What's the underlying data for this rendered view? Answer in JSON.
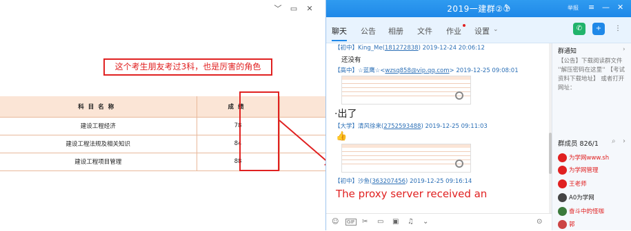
{
  "left_window": {
    "minimize": "﹀",
    "restore": "▭",
    "close": "✕",
    "annotation": "这个考生朋友考过3科，也是厉害的角色",
    "table": {
      "col_subject": "科目名称",
      "col_score": "成绩",
      "rows": [
        {
          "subject": "建设工程经济",
          "score": "78"
        },
        {
          "subject": "建设工程法规及相关知识",
          "score": "84"
        },
        {
          "subject": "建设工程项目管理",
          "score": "88"
        }
      ]
    }
  },
  "chat": {
    "title": "2019一建群②①",
    "report": "举报",
    "tabs": [
      "聊天",
      "公告",
      "相册",
      "文件",
      "作业",
      "设置"
    ],
    "messages": [
      {
        "tag": "【初中】",
        "name": "King_Me",
        "uid": "181272838",
        "time": "2019-12-24 20:06:12",
        "text": "还没有"
      },
      {
        "tag": "【高中】",
        "name": "☆蓝鹰☆",
        "uid": "wzsq858@vip.qq.com",
        "time": "2019-12-25 09:08:01"
      },
      {
        "text": "出了"
      },
      {
        "tag": "【大学】",
        "name": "清风徐来",
        "uid": "2752593488",
        "time": "2019-12-25 09:11:03",
        "emoji": "👍"
      },
      {
        "tag": "【初中】",
        "name": "沙鱼",
        "uid": "363207456",
        "time": "2019-12-25 09:16:14",
        "text": "The proxy server received an"
      }
    ],
    "notice": {
      "title": "群通知",
      "text": "【公告】下载阅读群文件 ''解压密码在这里'' 【考试资料下载地址】 或者打开网址："
    },
    "members": {
      "title": "群成员 826/1",
      "list": [
        {
          "name": "为学网www.sh",
          "color": "#e02020"
        },
        {
          "name": "为学网管理",
          "color": "#e02020"
        },
        {
          "name": "王老师",
          "color": "#e02020"
        },
        {
          "name": "A0为学网",
          "color": "#222222"
        },
        {
          "name": "奋斗中的怪咖",
          "color": "#e02020"
        },
        {
          "name": "郭",
          "color": "#e02020"
        }
      ]
    },
    "toolbar_hint": "GIF"
  }
}
